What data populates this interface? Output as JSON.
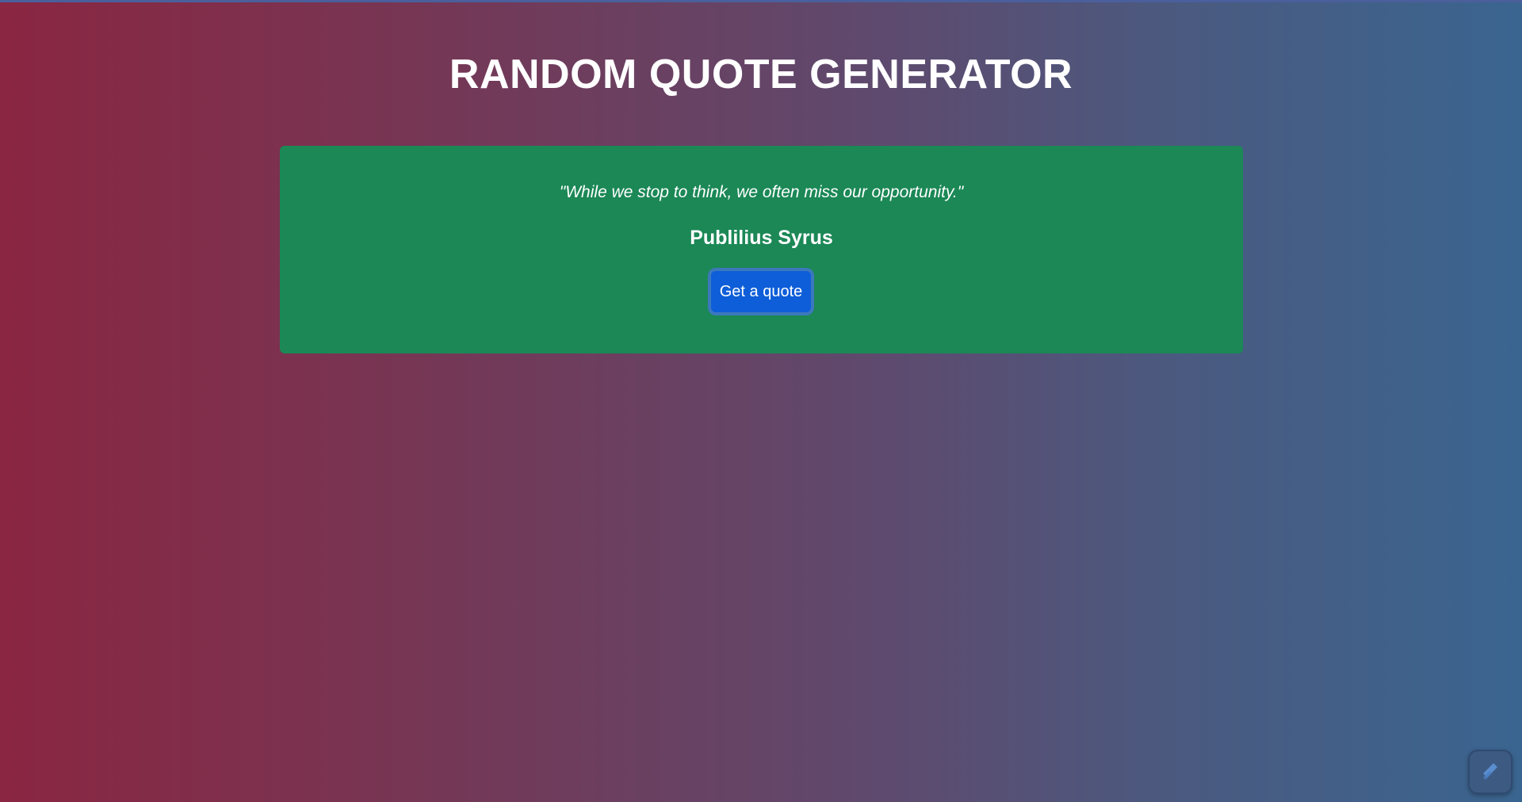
{
  "header": {
    "title": "RANDOM QUOTE GENERATOR"
  },
  "quote_box": {
    "text": "\"While we stop to think, we often miss our opportunity.\"",
    "author": "Publilius Syrus",
    "button_label": "Get a quote"
  },
  "corner_widget": {
    "icon": "pen-stroke-icon"
  },
  "colors": {
    "background_left": "#8a2642",
    "background_right": "#3a6590",
    "card": "#1b8856",
    "button": "#0d5ed8",
    "text": "#ffffff"
  }
}
